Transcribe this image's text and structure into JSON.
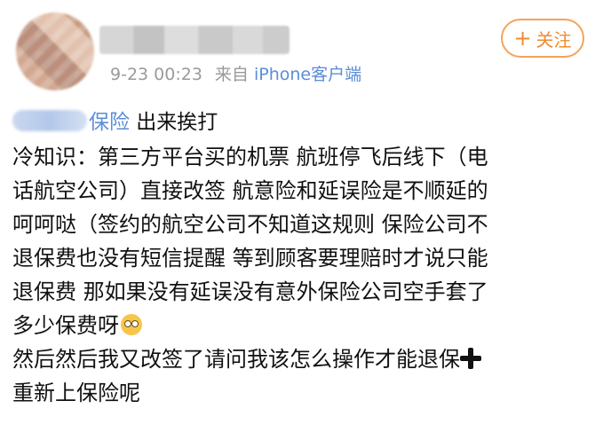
{
  "header": {
    "time": "9-23 00:23",
    "source_prefix": "来自",
    "source": "iPhone客户端",
    "follow_label": "关注",
    "follow_icon": "plus-icon"
  },
  "post": {
    "mention_tail": "保险",
    "mention_after": " 出来挨打",
    "lines": [
      "冷知识：第三方平台买的机票 航班停飞后线下（电",
      "话航空公司）直接改签 航意险和延误险是不顺延的",
      "呵呵哒（签约的航空公司不知道这规则 保险公司不",
      "退保费也没有短信提醒 等到顾客要理赔时才说只能",
      "退保费 那如果没有延误没有意外保险公司空手套了",
      "多少保费呀",
      "然后然后我又改签了请问我该怎么操作才能退保",
      "重新上保险呢"
    ],
    "emoji_icon": "rolling-eyes-emoji-icon",
    "plus_icon": "heavy-plus-icon"
  }
}
